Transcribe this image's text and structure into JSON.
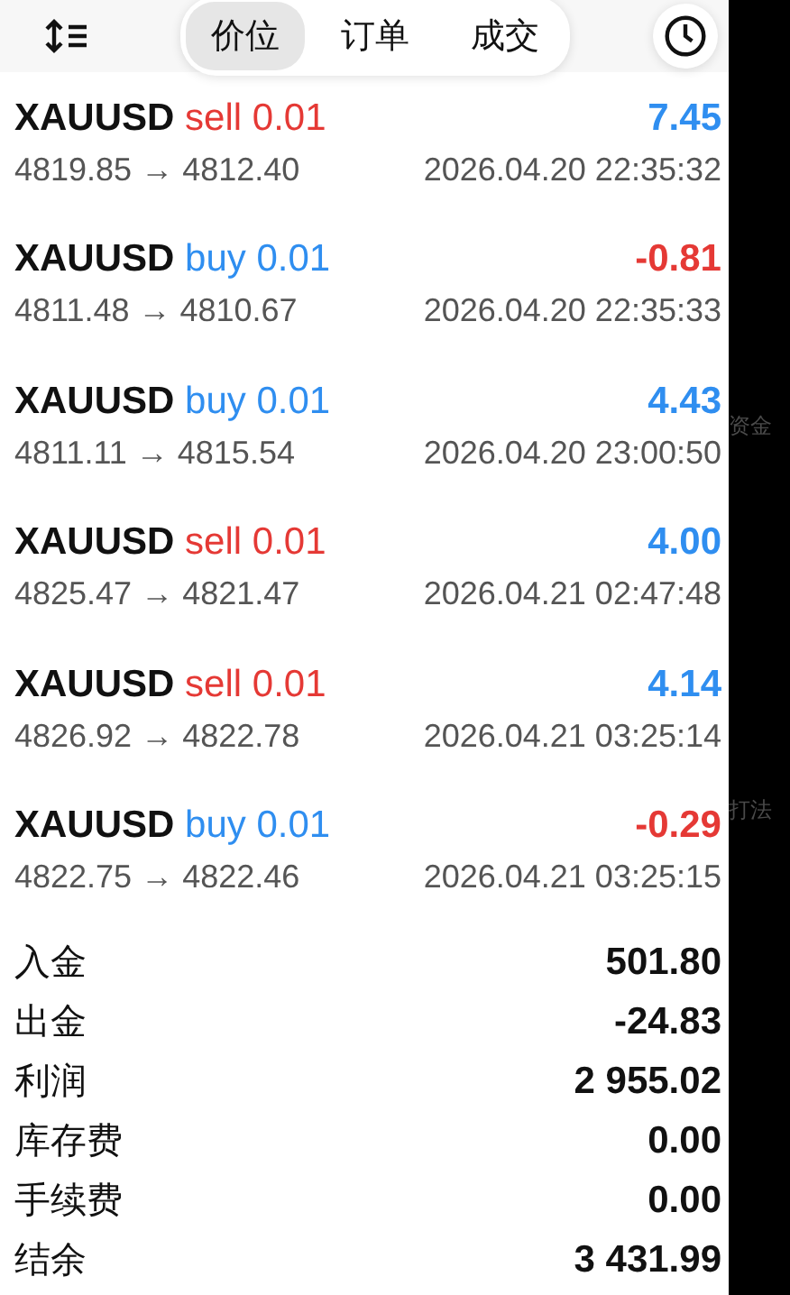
{
  "toolbar": {
    "tabs": [
      {
        "label": "价位",
        "selected": true
      },
      {
        "label": "订单",
        "selected": false
      },
      {
        "label": "成交",
        "selected": false
      }
    ]
  },
  "deals": [
    {
      "symbol": "XAUUSD",
      "side": "sell",
      "volume": "0.01",
      "profit": "7.45",
      "profit_positive": true,
      "prices": "4819.85 → 4812.40",
      "time": "2026.04.20 22:35:32"
    },
    {
      "symbol": "XAUUSD",
      "side": "buy",
      "volume": "0.01",
      "profit": "-0.81",
      "profit_positive": false,
      "prices": "4811.48 → 4810.67",
      "time": "2026.04.20 22:35:33"
    },
    {
      "symbol": "XAUUSD",
      "side": "buy",
      "volume": "0.01",
      "profit": "4.43",
      "profit_positive": true,
      "prices": "4811.11 → 4815.54",
      "time": "2026.04.20 23:00:50"
    },
    {
      "symbol": "XAUUSD",
      "side": "sell",
      "volume": "0.01",
      "profit": "4.00",
      "profit_positive": true,
      "prices": "4825.47 → 4821.47",
      "time": "2026.04.21 02:47:48"
    },
    {
      "symbol": "XAUUSD",
      "side": "sell",
      "volume": "0.01",
      "profit": "4.14",
      "profit_positive": true,
      "prices": "4826.92 → 4822.78",
      "time": "2026.04.21 03:25:14"
    },
    {
      "symbol": "XAUUSD",
      "side": "buy",
      "volume": "0.01",
      "profit": "-0.29",
      "profit_positive": false,
      "prices": "4822.75 → 4822.46",
      "time": "2026.04.21 03:25:15"
    }
  ],
  "summary": [
    {
      "label": "入金",
      "value": "501.80"
    },
    {
      "label": "出金",
      "value": "-24.83"
    },
    {
      "label": "利润",
      "value": "2 955.02"
    },
    {
      "label": "库存费",
      "value": "0.00"
    },
    {
      "label": "手续费",
      "value": "0.00"
    },
    {
      "label": "结余",
      "value": "3 431.99"
    }
  ],
  "background_texts": [
    "资金",
    "打法"
  ]
}
